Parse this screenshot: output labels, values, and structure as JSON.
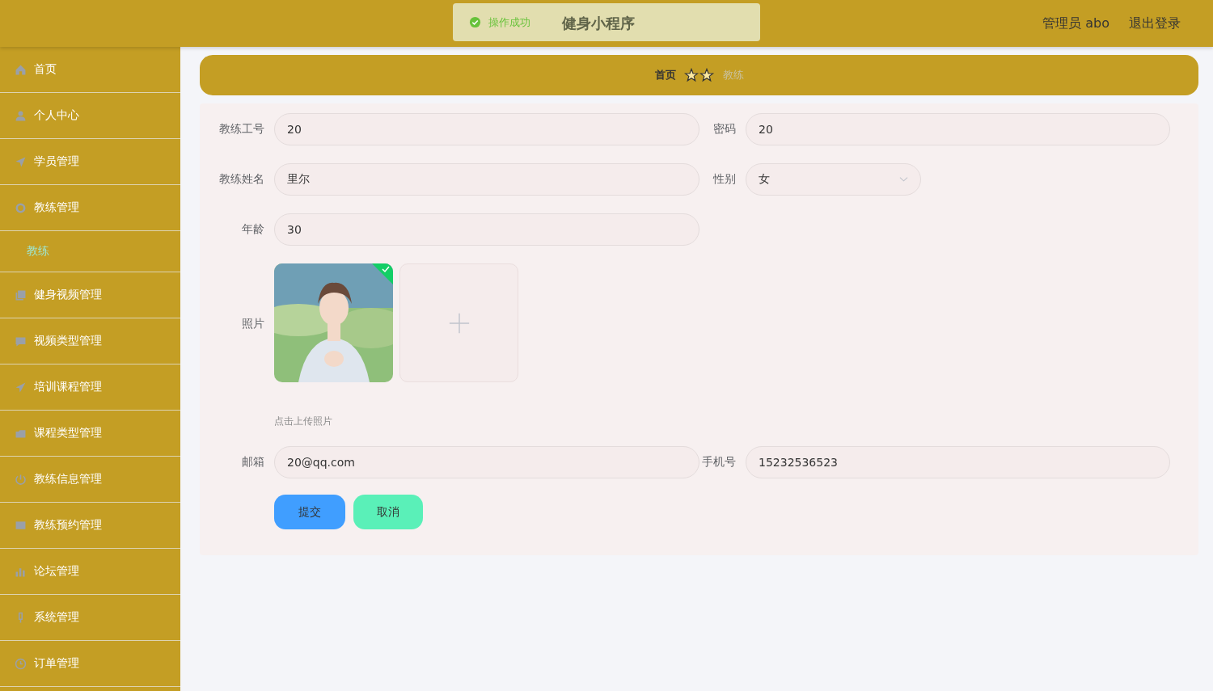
{
  "header": {
    "title": "健身小程序",
    "user": "管理员 abo",
    "logout": "退出登录"
  },
  "toast": {
    "message": "操作成功"
  },
  "sidebar": {
    "items": [
      {
        "label": "首页"
      },
      {
        "label": "个人中心"
      },
      {
        "label": "学员管理"
      },
      {
        "label": "教练管理",
        "children": [
          {
            "label": "教练",
            "selected": true
          }
        ]
      },
      {
        "label": "健身视频管理"
      },
      {
        "label": "视频类型管理"
      },
      {
        "label": "培训课程管理"
      },
      {
        "label": "课程类型管理"
      },
      {
        "label": "教练信息管理"
      },
      {
        "label": "教练预约管理"
      },
      {
        "label": "论坛管理"
      },
      {
        "label": "系统管理"
      },
      {
        "label": "订单管理"
      }
    ]
  },
  "breadcrumb": [
    {
      "label": "首页",
      "current": false
    },
    {
      "label": "教练",
      "current": true
    }
  ],
  "form": {
    "fields": [
      {
        "kind": "input",
        "label": "教练工号",
        "value": "20"
      },
      {
        "kind": "input",
        "label": "密码",
        "value": "20"
      },
      {
        "kind": "input",
        "label": "教练姓名",
        "value": "里尔"
      },
      {
        "kind": "select",
        "label": "性别",
        "value": "女"
      },
      {
        "kind": "input",
        "label": "年龄",
        "value": "30"
      },
      {
        "kind": "upload",
        "label": "照片",
        "hint": "点击上传照片"
      },
      {
        "kind": "input",
        "label": "邮箱",
        "value": "20@qq.com"
      },
      {
        "kind": "input",
        "label": "手机号",
        "value": "15232536523"
      }
    ],
    "buttons": [
      {
        "label": "提交",
        "kind": "primary"
      },
      {
        "label": "取消",
        "kind": "cancel"
      }
    ]
  }
}
